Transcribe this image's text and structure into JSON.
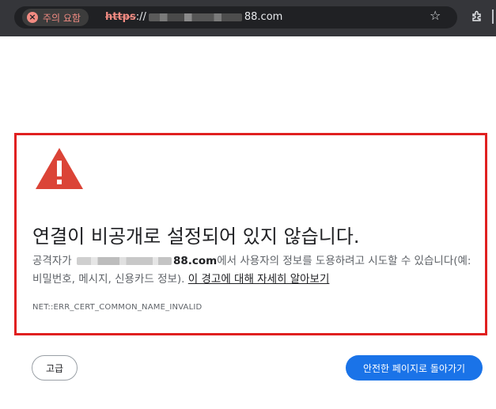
{
  "browser": {
    "security_chip": {
      "label": "주의 요함",
      "icon": "warning-circle-icon",
      "color": "#f28b82"
    },
    "url": {
      "protocol": "https",
      "separator": "://",
      "domain_suffix": "88.com"
    },
    "icons": {
      "bookmark": "star-icon",
      "extensions": "puzzle-icon"
    }
  },
  "error_page": {
    "headline": "연결이 비공개로 설정되어 있지 않습니다.",
    "body_prefix": "공격자가 ",
    "body_domain_suffix": "88.com",
    "body_middle": "에서 사용자의 정보를 도용하려고 시도할 수 있습니다(예: 비밀번호, 메시지, 신용카드 정보). ",
    "learn_more_link": "이 경고에 대해 자세히 알아보기",
    "error_code": "NET::ERR_CERT_COMMON_NAME_INVALID",
    "icon": "warning-triangle-icon",
    "icon_color": "#db4437",
    "highlight_border_color": "#e02020"
  },
  "actions": {
    "advanced_label": "고급",
    "back_to_safety_label": "안전한 페이지로 돌아가기",
    "primary_color": "#1a73e8"
  }
}
